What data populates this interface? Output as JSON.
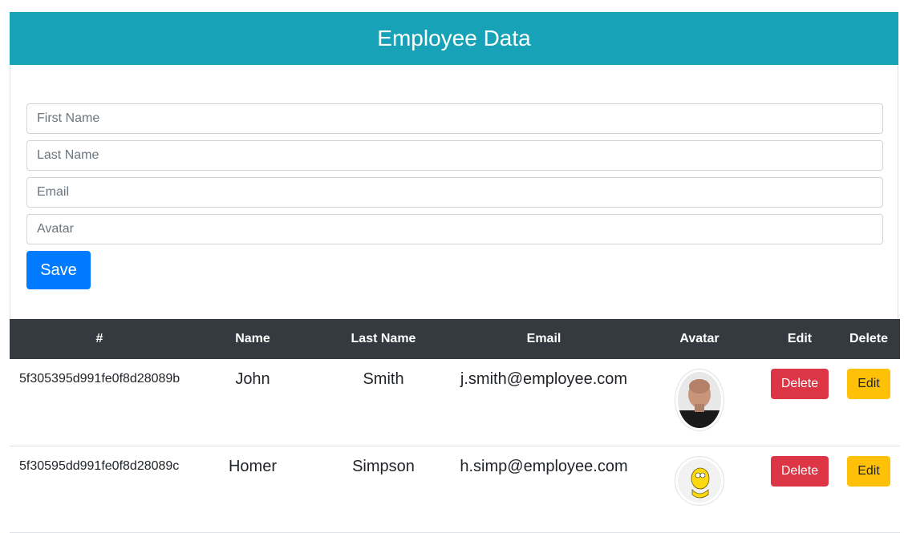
{
  "header": {
    "title": "Employee Data"
  },
  "form": {
    "first_name_placeholder": "First Name",
    "last_name_placeholder": "Last Name",
    "email_placeholder": "Email",
    "avatar_placeholder": "Avatar",
    "save_label": "Save"
  },
  "table": {
    "columns": [
      "#",
      "Name",
      "Last Name",
      "Email",
      "Avatar",
      "Edit",
      "Delete"
    ],
    "rows": [
      {
        "id": "5f305395d991fe0f8d28089b",
        "name": "John",
        "last_name": "Smith",
        "email": "j.smith@employee.com",
        "avatar_icon": "person-photo-avatar",
        "edit_col_button": "Delete",
        "delete_col_button": "Edit"
      },
      {
        "id": "5f30595dd991fe0f8d28089c",
        "name": "Homer",
        "last_name": "Simpson",
        "email": "h.simp@employee.com",
        "avatar_icon": "cartoon-avatar",
        "edit_col_button": "Delete",
        "delete_col_button": "Edit"
      }
    ]
  },
  "colors": {
    "header_bg": "#17a2b8",
    "table_head_bg": "#343a40",
    "primary": "#007bff",
    "danger": "#dc3545",
    "warning": "#ffc107"
  }
}
